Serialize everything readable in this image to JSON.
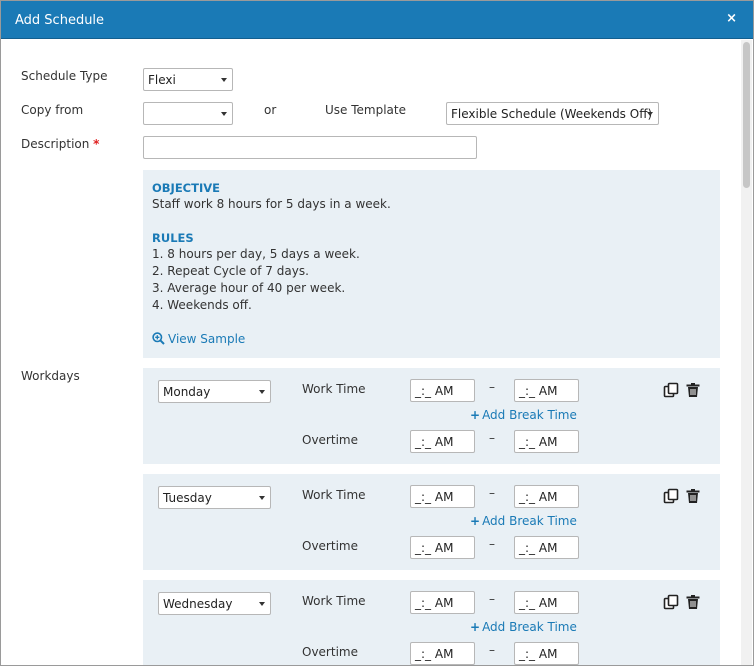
{
  "dialog": {
    "title": "Add Schedule",
    "close_label": "×"
  },
  "form": {
    "schedule_type": {
      "label": "Schedule Type",
      "value": "Flexi"
    },
    "copy_from": {
      "label": "Copy from",
      "value": ""
    },
    "or_label": "or",
    "use_template": {
      "label": "Use Template",
      "value": "Flexible Schedule (Weekends Off)"
    },
    "description": {
      "label": "Description",
      "required_mark": "*",
      "value": ""
    }
  },
  "info": {
    "objective_heading": "OBJECTIVE",
    "objective_text": "Staff work 8 hours for 5 days in a week.",
    "rules_heading": "RULES",
    "rules": [
      "1. 8 hours per day, 5 days a week.",
      "2. Repeat Cycle of 7 days.",
      "3. Average hour of 40 per week.",
      "4. Weekends off."
    ],
    "view_sample": "View Sample"
  },
  "workdays": {
    "label": "Workdays",
    "work_time_label": "Work Time",
    "overtime_label": "Overtime",
    "add_break_label": "Add Break Time",
    "range_separator": "–",
    "time_placeholder": "_:_ AM",
    "days": [
      {
        "name": "Monday"
      },
      {
        "name": "Tuesday"
      },
      {
        "name": "Wednesday"
      }
    ]
  },
  "colors": {
    "accent": "#1a7ab6",
    "panel": "#e9f0f5",
    "required": "#e02020"
  }
}
